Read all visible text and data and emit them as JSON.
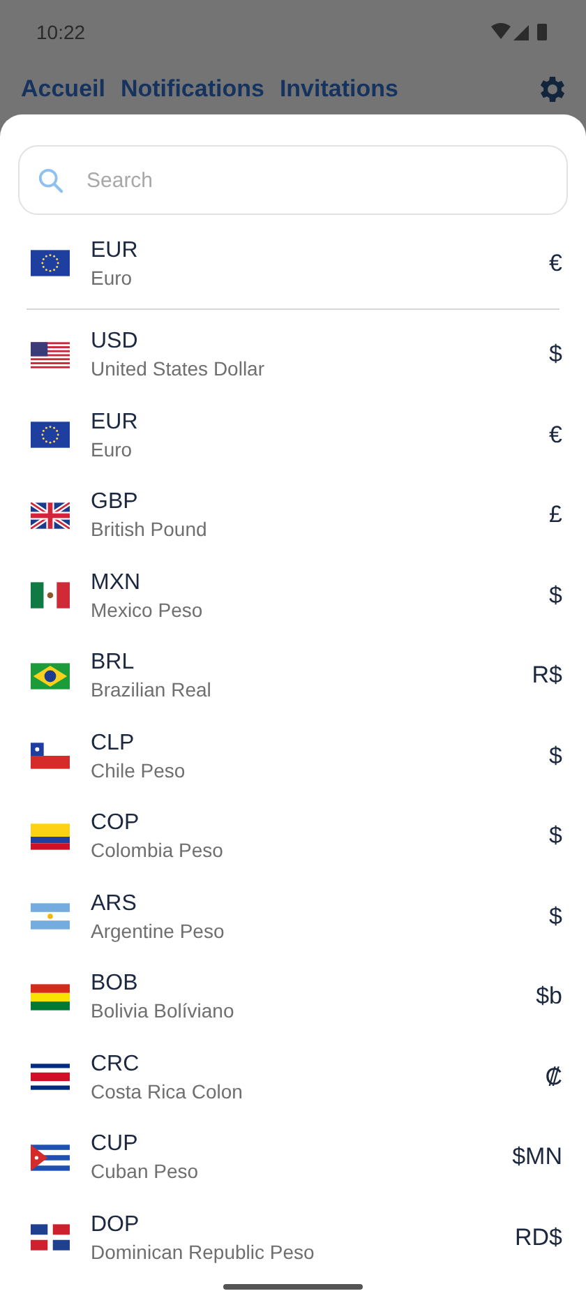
{
  "status_bar": {
    "time": "10:22"
  },
  "header": {
    "tabs": [
      {
        "label": "Accueil"
      },
      {
        "label": "Notifications"
      },
      {
        "label": "Invitations"
      }
    ]
  },
  "search": {
    "placeholder": "Search"
  },
  "selected_currency": {
    "kind": "eu",
    "code": "EUR",
    "name": "Euro",
    "symbol": "€"
  },
  "currencies": [
    {
      "kind": "us",
      "code": "USD",
      "name": "United States Dollar",
      "symbol": "$"
    },
    {
      "kind": "eu",
      "code": "EUR",
      "name": "Euro",
      "symbol": "€"
    },
    {
      "kind": "gb",
      "code": "GBP",
      "name": "British Pound",
      "symbol": "£"
    },
    {
      "kind": "mx",
      "code": "MXN",
      "name": "Mexico Peso",
      "symbol": "$"
    },
    {
      "kind": "br",
      "code": "BRL",
      "name": "Brazilian Real",
      "symbol": "R$"
    },
    {
      "kind": "cl",
      "code": "CLP",
      "name": "Chile Peso",
      "symbol": "$"
    },
    {
      "kind": "co",
      "code": "COP",
      "name": "Colombia Peso",
      "symbol": "$"
    },
    {
      "kind": "ar",
      "code": "ARS",
      "name": "Argentine Peso",
      "symbol": "$"
    },
    {
      "kind": "bo",
      "code": "BOB",
      "name": "Bolivia Bolíviano",
      "symbol": "$b"
    },
    {
      "kind": "cr",
      "code": "CRC",
      "name": "Costa Rica Colon",
      "symbol": "₡"
    },
    {
      "kind": "cu",
      "code": "CUP",
      "name": "Cuban Peso",
      "symbol": "$MN"
    },
    {
      "kind": "do",
      "code": "DOP",
      "name": "Dominican Republic Peso",
      "symbol": "RD$"
    }
  ]
}
